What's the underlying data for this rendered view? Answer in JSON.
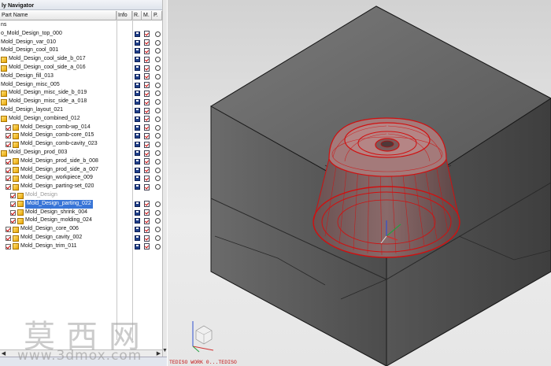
{
  "navigator": {
    "title": "ly Navigator",
    "columns": {
      "part_name": "Part Name",
      "info": "Info",
      "r": "R.",
      "m": "M.",
      "p": "P."
    },
    "rows": [
      {
        "indent": 0,
        "label": "ns",
        "check": false,
        "icon": false,
        "status": false
      },
      {
        "indent": 0,
        "label": "o_Mold_Design_top_000",
        "check": false,
        "icon": false,
        "status": true
      },
      {
        "indent": 0,
        "label": "Mold_Design_var_010",
        "check": false,
        "icon": false,
        "status": true
      },
      {
        "indent": 0,
        "label": "Mold_Design_cool_001",
        "check": false,
        "icon": false,
        "status": true
      },
      {
        "indent": 0,
        "label": "Mold_Design_cool_side_b_017",
        "check": false,
        "icon": true,
        "status": true
      },
      {
        "indent": 0,
        "label": "Mold_Design_cool_side_a_016",
        "check": false,
        "icon": true,
        "status": true
      },
      {
        "indent": 0,
        "label": "Mold_Design_fill_013",
        "check": false,
        "icon": false,
        "status": true
      },
      {
        "indent": 0,
        "label": "Mold_Design_misc_005",
        "check": false,
        "icon": false,
        "status": true
      },
      {
        "indent": 0,
        "label": "Mold_Design_misc_side_b_019",
        "check": false,
        "icon": true,
        "status": true
      },
      {
        "indent": 0,
        "label": "Mold_Design_misc_side_a_018",
        "check": false,
        "icon": true,
        "status": true
      },
      {
        "indent": 0,
        "label": "Mold_Design_layout_021",
        "check": false,
        "icon": false,
        "status": true
      },
      {
        "indent": 0,
        "label": "Mold_Design_combined_012",
        "check": false,
        "icon": true,
        "status": true
      },
      {
        "indent": 1,
        "label": "Mold_Design_comb-wp_014",
        "check": true,
        "icon": true,
        "status": true
      },
      {
        "indent": 1,
        "label": "Mold_Design_comb-core_015",
        "check": true,
        "icon": true,
        "status": true
      },
      {
        "indent": 1,
        "label": "Mold_Design_comb-cavity_023",
        "check": true,
        "icon": true,
        "status": true
      },
      {
        "indent": 0,
        "label": "Mold_Design_prod_003",
        "check": false,
        "icon": true,
        "status": true
      },
      {
        "indent": 1,
        "label": "Mold_Design_prod_side_b_008",
        "check": true,
        "icon": true,
        "status": true
      },
      {
        "indent": 1,
        "label": "Mold_Design_prod_side_a_007",
        "check": true,
        "icon": true,
        "status": true
      },
      {
        "indent": 1,
        "label": "Mold_Design_workpiece_009",
        "check": true,
        "icon": true,
        "status": true
      },
      {
        "indent": 1,
        "label": "Mold_Design_parting-set_020",
        "check": true,
        "icon": true,
        "status": true
      },
      {
        "indent": 2,
        "label": "Mold_Design",
        "check": true,
        "icon": true,
        "status": false,
        "gray": true
      },
      {
        "indent": 2,
        "label": "Mold_Design_parting_022",
        "check": true,
        "icon": true,
        "status": true,
        "selected": true
      },
      {
        "indent": 2,
        "label": "Mold_Design_shrink_004",
        "check": true,
        "icon": true,
        "status": true
      },
      {
        "indent": 2,
        "label": "Mold_Design_molding_024",
        "check": true,
        "icon": true,
        "status": true
      },
      {
        "indent": 1,
        "label": "Mold_Design_core_006",
        "check": true,
        "icon": true,
        "status": true
      },
      {
        "indent": 1,
        "label": "Mold_Design_cavity_002",
        "check": true,
        "icon": true,
        "status": true
      },
      {
        "indent": 1,
        "label": "Mold_Design_trim_011",
        "check": true,
        "icon": true,
        "status": true
      }
    ]
  },
  "viewport": {
    "status_text": "TEDISO WORK 0...TEDISO",
    "colors": {
      "block": "#5b5b5b",
      "edge": "#1a1a1a",
      "part": "#d01010",
      "background": "#e2e2e2"
    }
  },
  "watermark": {
    "cn": "莫西网",
    "url": "www.3dmox.com"
  },
  "icons": [
    "checkbox-icon",
    "part-icon",
    "save-disk-icon",
    "page-icon",
    "radio-icon",
    "view-triad-icon"
  ]
}
